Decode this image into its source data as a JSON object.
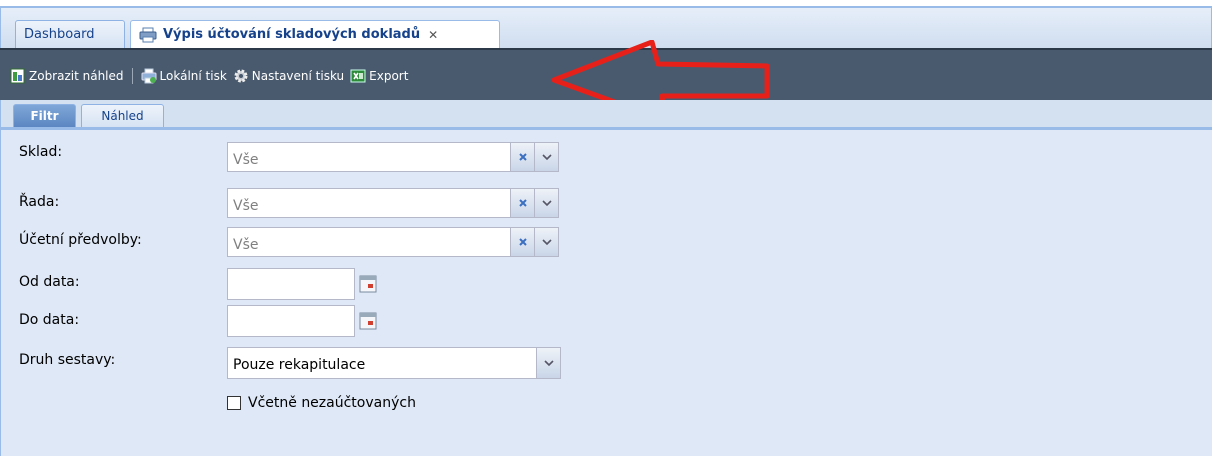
{
  "tabs": {
    "dashboard": "Dashboard",
    "report": "Výpis účtování skladových dokladů",
    "close_glyph": "✕"
  },
  "toolbar": {
    "preview": "Zobrazit náhled",
    "local_print": "Lokální tisk",
    "print_settings": "Nastavení tisku",
    "export": "Export"
  },
  "subtabs": {
    "filter": "Filtr",
    "preview": "Náhled"
  },
  "form": {
    "warehouse": {
      "label": "Sklad:",
      "value": "Vše"
    },
    "series": {
      "label": "Řada:",
      "value": "Vše"
    },
    "accounting_presets": {
      "label": "Účetní předvolby:",
      "value": "Vše"
    },
    "date_from": {
      "label": "Od data:",
      "value": ""
    },
    "date_to": {
      "label": "Do data:",
      "value": ""
    },
    "report_type": {
      "label": "Druh sestavy:",
      "value": "Pouze rekapitulace"
    },
    "include_unposted": {
      "label": "Včetně nezaúčtovaných",
      "checked": false
    }
  },
  "colors": {
    "toolbar_bg": "#4a5a6e",
    "panel_bg": "#dfe8f6",
    "annotation_arrow": "#e8201a"
  },
  "icons": [
    "printer-icon",
    "preview-icon",
    "gear-icon",
    "excel-export-icon",
    "clear-icon",
    "chevron-down-icon",
    "calendar-icon",
    "arrow-annotation"
  ]
}
